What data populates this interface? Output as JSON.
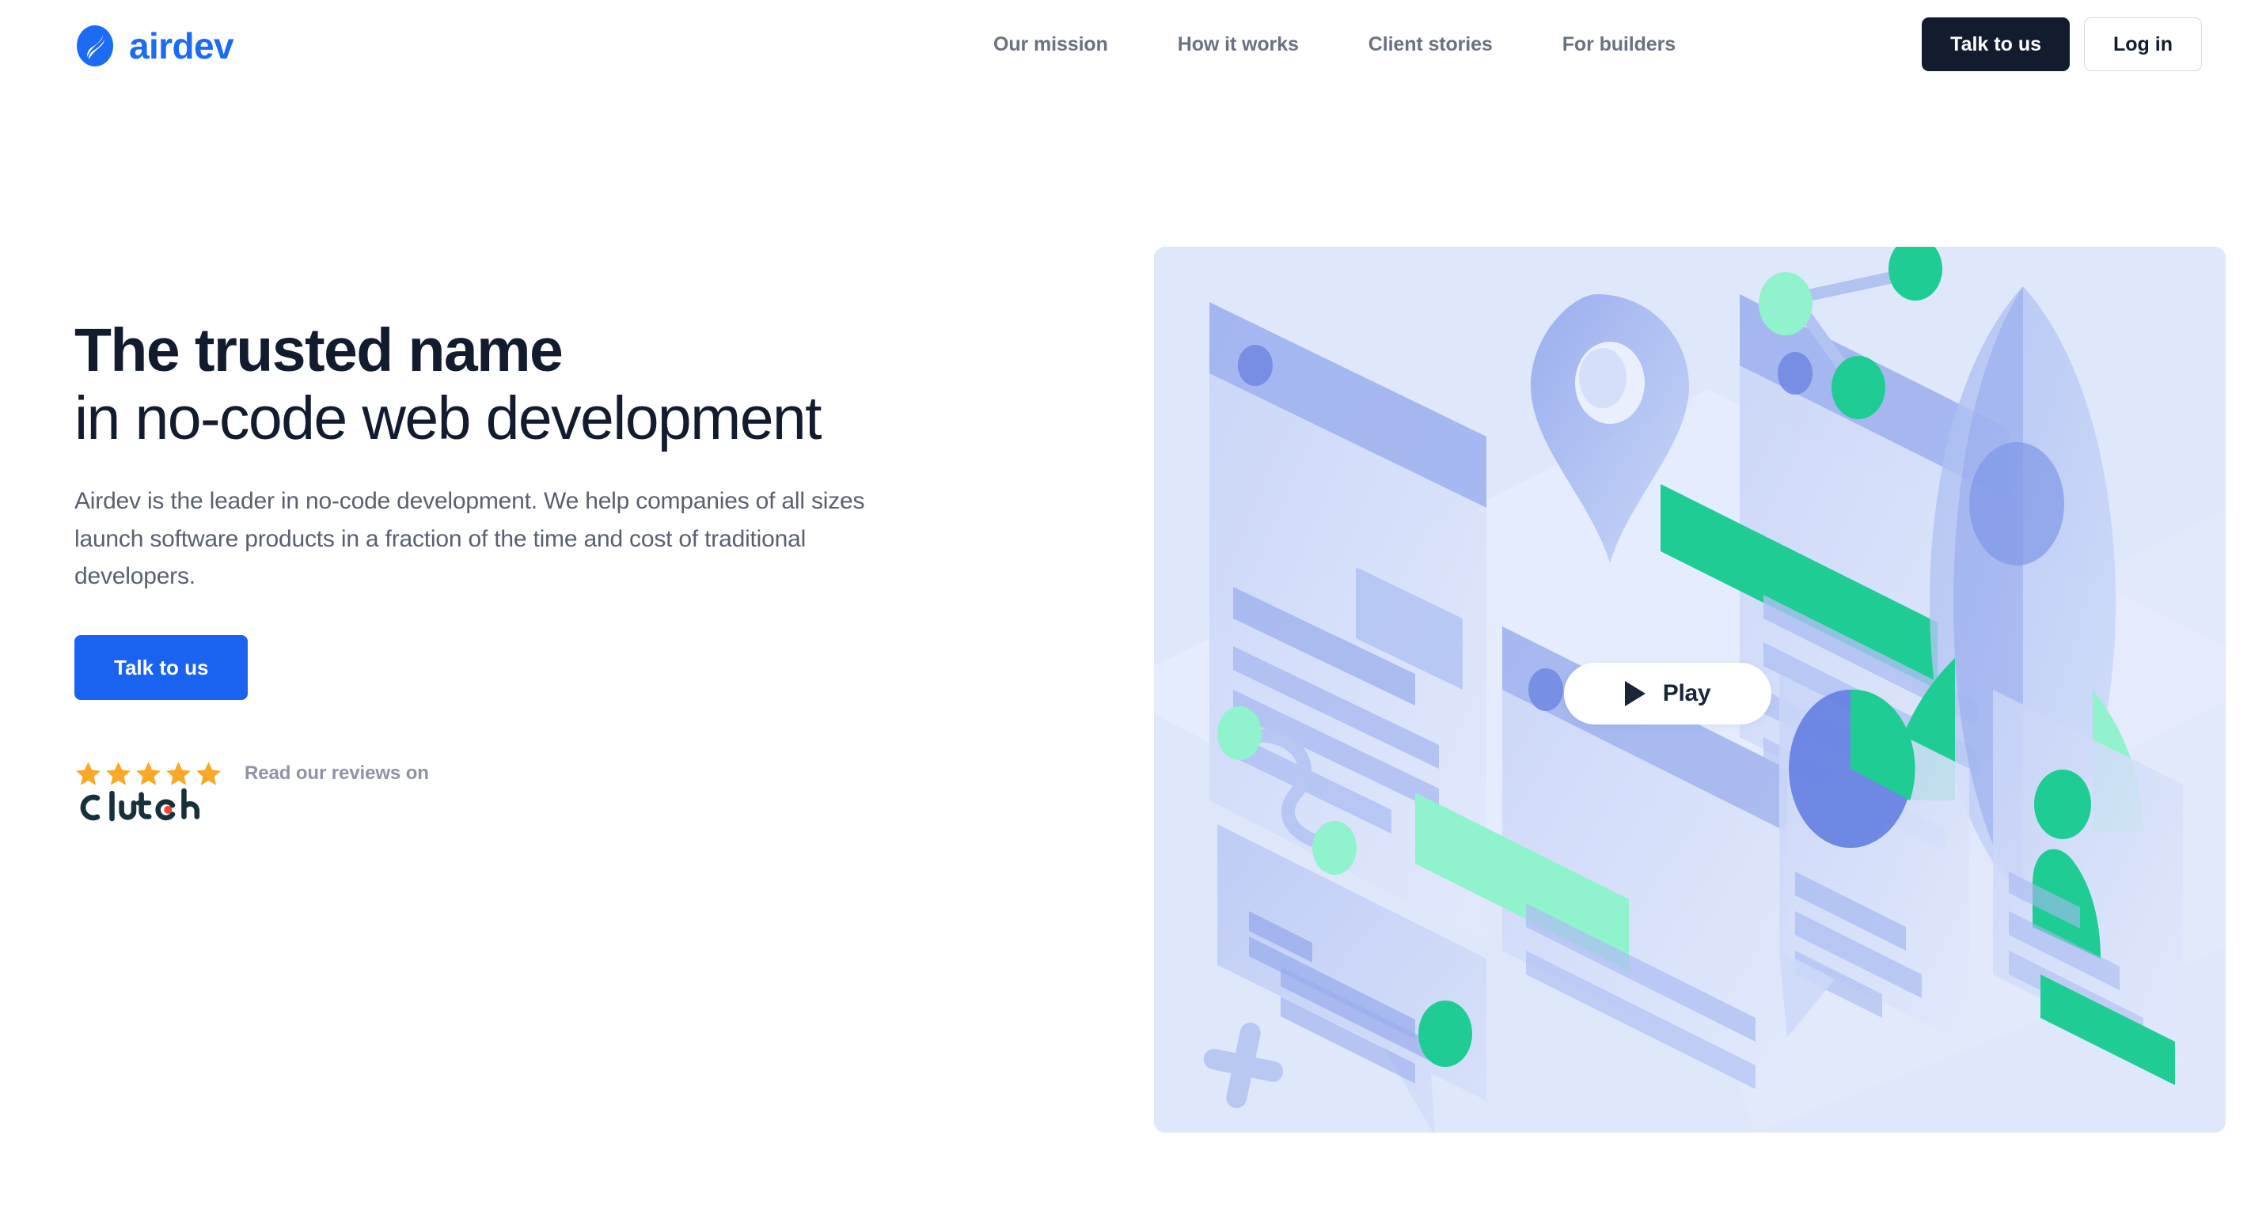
{
  "brand": {
    "name": "airdev",
    "logo_icon": "airdev-wave-logo",
    "color": "#1b6cf3"
  },
  "nav": {
    "items": [
      {
        "label": "Our mission"
      },
      {
        "label": "How it works"
      },
      {
        "label": "Client stories"
      },
      {
        "label": "For builders"
      }
    ],
    "primary_cta": "Talk to us",
    "secondary_cta": "Log in"
  },
  "hero": {
    "headline_strong": "The trusted name",
    "headline_light": "in no-code web development",
    "subtext": "Airdev is the leader in no-code development. We help companies of all sizes launch software products in a fraction of the time and cost of traditional developers.",
    "cta_label": "Talk to us",
    "cta_color": "#1a63f0",
    "headline_color": "#131c2e"
  },
  "reviews": {
    "label": "Read our reviews on",
    "platform": "Clutch",
    "rating": 5,
    "max_rating": 5,
    "star_color": "#f9a828",
    "clutch_dot_color": "#ef4335",
    "clutch_text_color": "#17313b"
  },
  "illustration": {
    "play_label": "Play",
    "play_icon": "play-triangle-icon",
    "background_color": "#dfe7fb",
    "accent_green": "#1fcc94",
    "accent_mint": "#90f3cd",
    "accent_blue": "#93a8ec"
  }
}
